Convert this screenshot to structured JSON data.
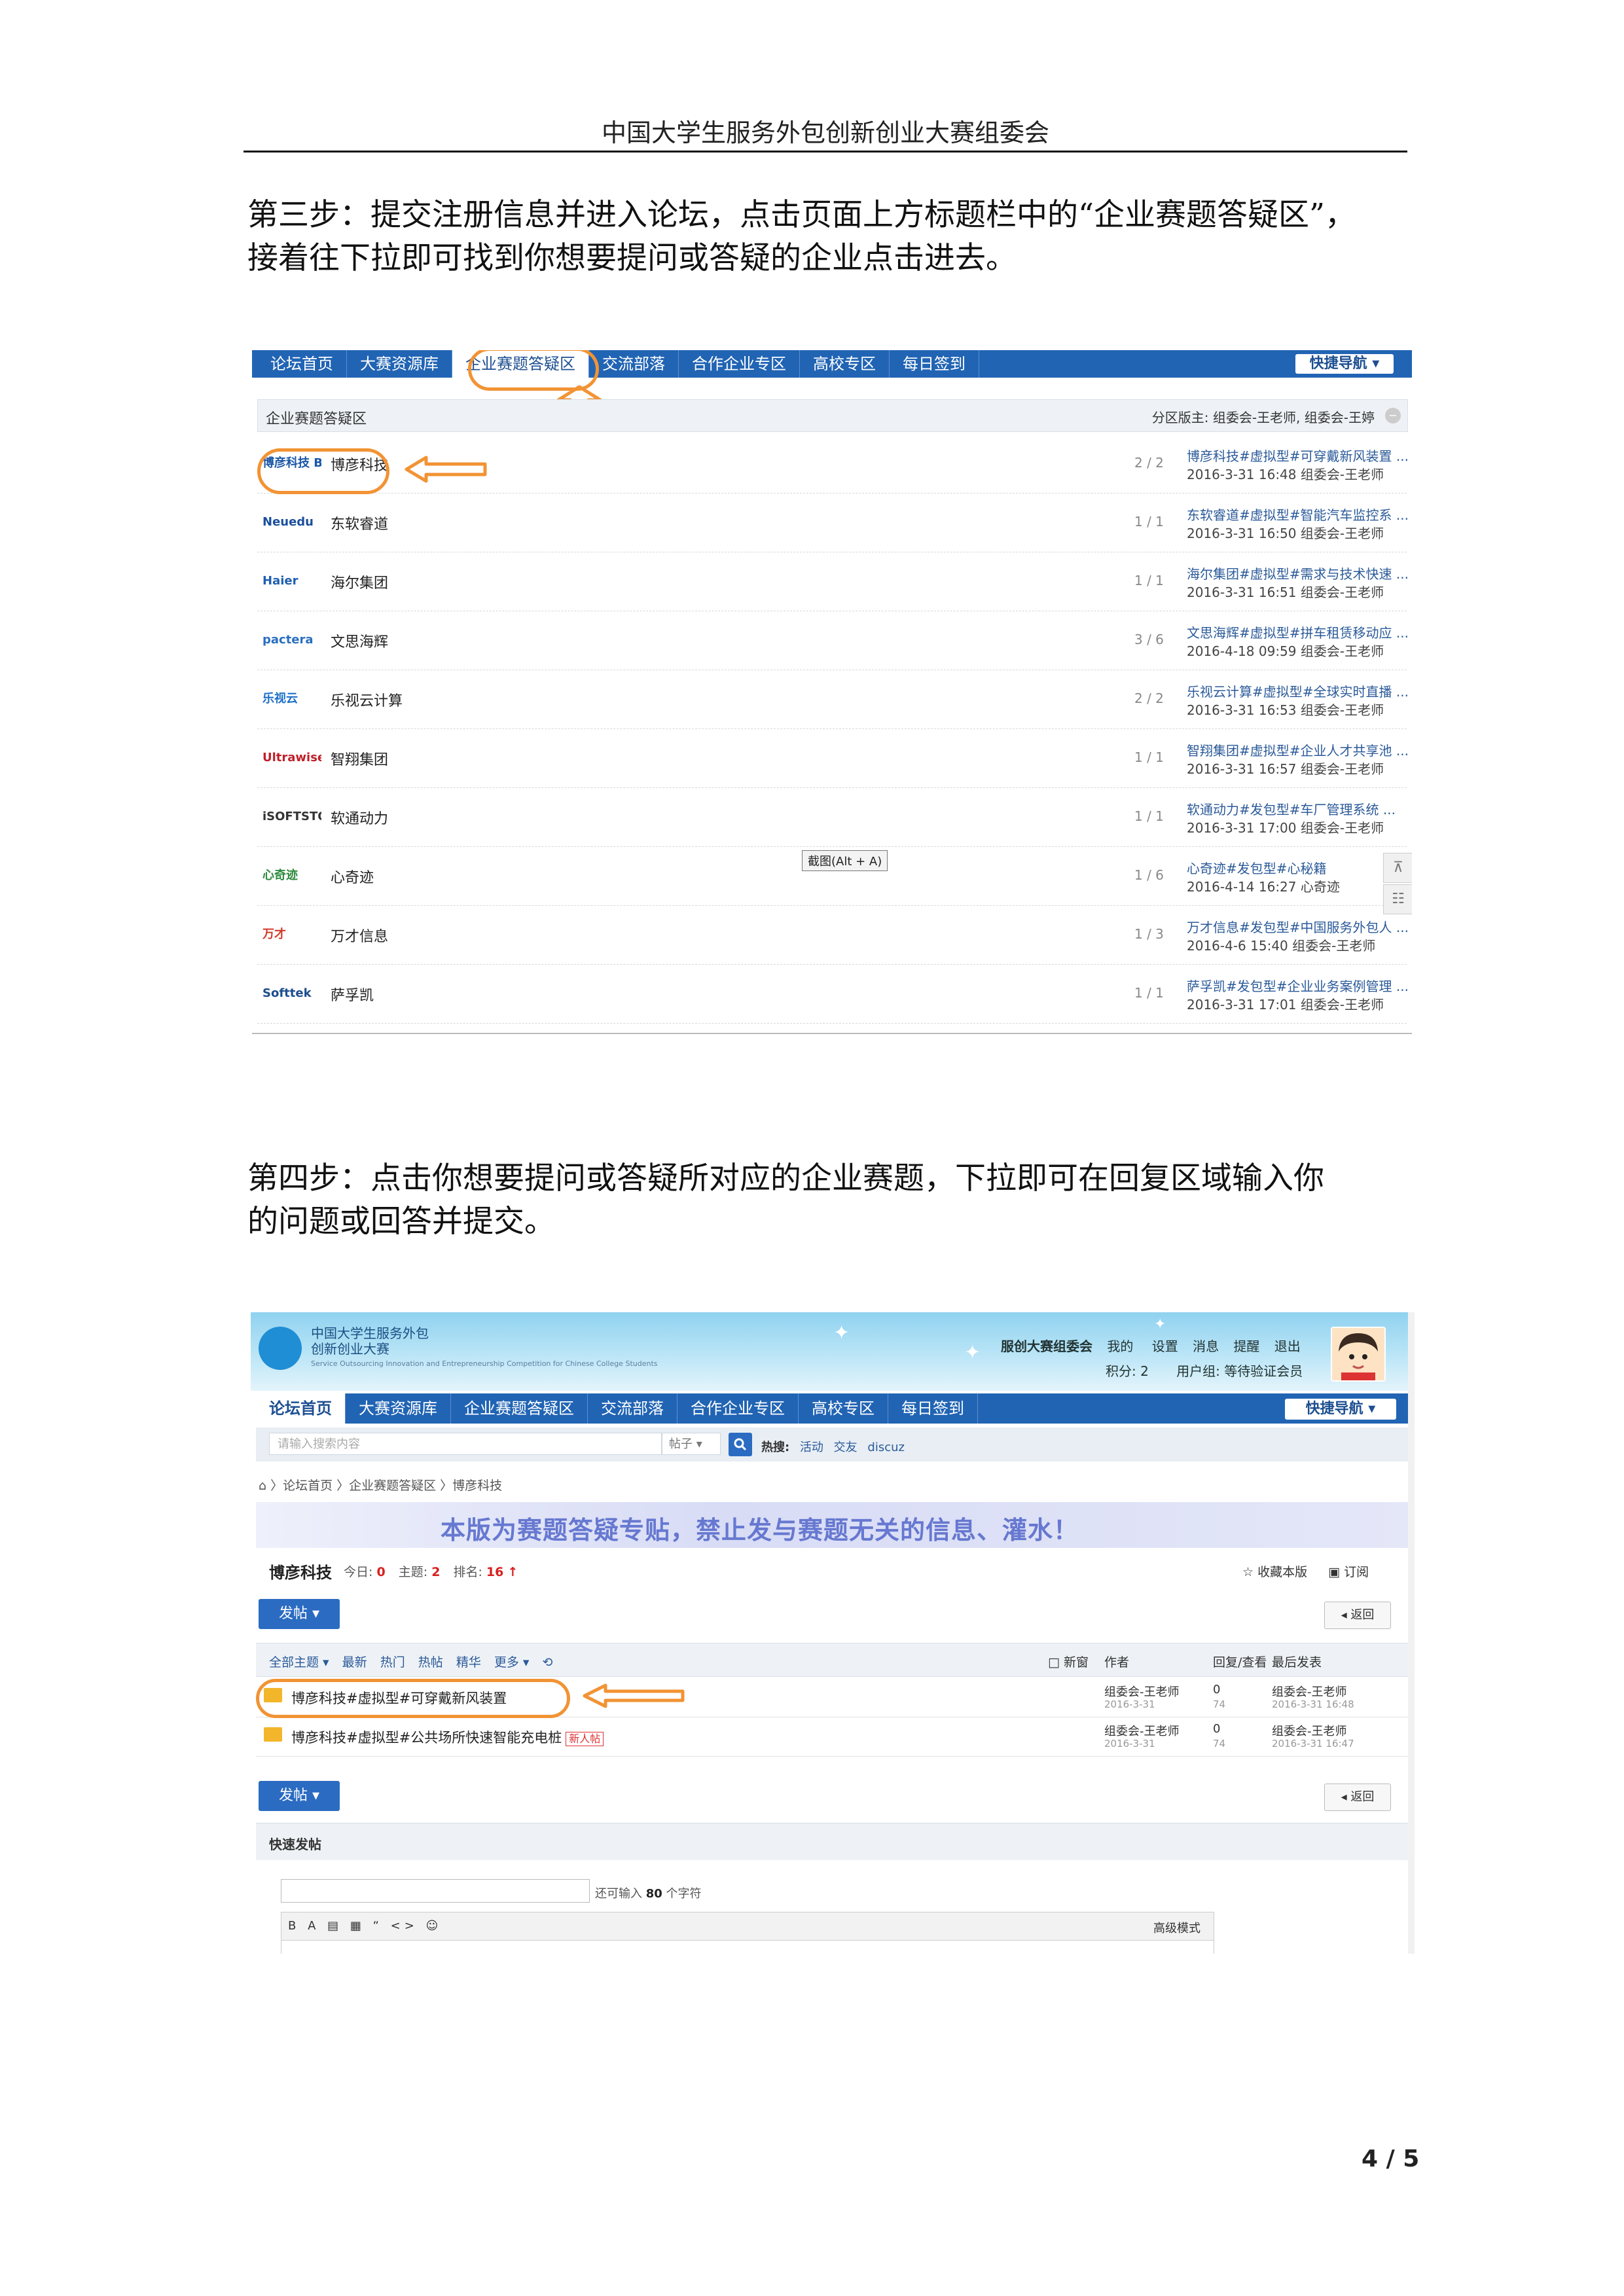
{
  "header": {
    "title": "中国大学生服务外包创新创业大赛组委会"
  },
  "step3": {
    "line1": "第三步：提交注册信息并进入论坛，点击页面上方标题栏中的“企业赛题答疑区”，",
    "line2": "接着往下拉即可找到你想要提问或答疑的企业点击进去。"
  },
  "shot1": {
    "nav_tabs": [
      "论坛首页",
      "大赛资源库",
      "企业赛题答疑区",
      "交流部落",
      "合作企业专区",
      "高校专区",
      "每日签到"
    ],
    "quick_nav": "快捷导航 ▾",
    "section_title": "企业赛题答疑区",
    "moderators": "分区版主: 组委会-王老师, 组委会-王婷",
    "collapse_icon": "−",
    "tooltip": "截图(Alt + A)",
    "side_tool_1": "⊼",
    "side_tool_2": "☷",
    "forums": [
      {
        "logo": "博彦科技 BEYONDSOFT",
        "name": "博彦科技",
        "count": "2 / 2",
        "latest": "博彦科技#虚拟型#可穿戴新风装置 ...",
        "meta": "2016-3-31 16:48 组委会-王老师",
        "logo_color": "#1a56a8"
      },
      {
        "logo": "Neuedu",
        "name": "东软睿道",
        "count": "1 / 1",
        "latest": "东软睿道#虚拟型#智能汽车监控系 ...",
        "meta": "2016-3-31 16:50 组委会-王老师",
        "logo_color": "#1a4f9c"
      },
      {
        "logo": "Haier",
        "name": "海尔集团",
        "count": "1 / 1",
        "latest": "海尔集团#虚拟型#需求与技术快速 ...",
        "meta": "2016-3-31 16:51 组委会-王老师",
        "logo_color": "#1f5fb0"
      },
      {
        "logo": "pactera",
        "name": "文思海辉",
        "count": "3 / 6",
        "latest": "文思海辉#虚拟型#拼车租赁移动应 ...",
        "meta": "2016-4-18 09:59 组委会-王老师",
        "logo_color": "#2a6fc0"
      },
      {
        "logo": "乐视云",
        "name": "乐视云计算",
        "count": "2 / 2",
        "latest": "乐视云计算#虚拟型#全球实时直播 ...",
        "meta": "2016-3-31 16:53 组委会-王老师",
        "logo_color": "#1d6fc7"
      },
      {
        "logo": "Ultrawise",
        "name": "智翔集团",
        "count": "1 / 1",
        "latest": "智翔集团#虚拟型#企业人才共享池 ...",
        "meta": "2016-3-31 16:57 组委会-王老师",
        "logo_color": "#c0202a"
      },
      {
        "logo": "iSOFTSTONE",
        "name": "软通动力",
        "count": "1 / 1",
        "latest": "软通动力#发包型#车厂管理系统 ...",
        "meta": "2016-3-31 17:00 组委会-王老师",
        "logo_color": "#333333"
      },
      {
        "logo": "心奇迹",
        "name": "心奇迹",
        "count": "1 / 6",
        "latest": "心奇迹#发包型#心秘籍",
        "meta": "2016-4-14 16:27 心奇迹",
        "logo_color": "#2d8a3e"
      },
      {
        "logo": "万才",
        "name": "万才信息",
        "count": "1 / 3",
        "latest": "万才信息#发包型#中国服务外包人 ...",
        "meta": "2016-4-6 15:40 组委会-王老师",
        "logo_color": "#d03a2a"
      },
      {
        "logo": "Softtek",
        "name": "萨孚凯",
        "count": "1 / 1",
        "latest": "萨孚凯#发包型#企业业务案例管理 ...",
        "meta": "2016-3-31 17:01 组委会-王老师",
        "logo_color": "#1c4e8c"
      }
    ]
  },
  "step4": {
    "line1": "第四步：点击你想要提问或答疑所对应的企业赛题，下拉即可在回复区域输入你",
    "line2": "的问题或回答并提交。"
  },
  "shot2": {
    "site_name_1": "中国大学生服务外包",
    "site_name_2": "创新创业大赛",
    "site_name_en": "Service Outsourcing Innovation and Entrepreneurship Competition for Chinese College Students",
    "user_name": "服创大赛组委会",
    "user_links": [
      "我的",
      "设置",
      "消息",
      "提醒",
      "退出"
    ],
    "points": "积分: 2",
    "user_group": "用户组: 等待验证会员",
    "nav_tabs": [
      "论坛首页",
      "大赛资源库",
      "企业赛题答疑区",
      "交流部落",
      "合作企业专区",
      "高校专区",
      "每日签到"
    ],
    "quick_nav": "快捷导航 ▾",
    "search_placeholder": "请输入搜索内容",
    "search_type": "帖子 ▾",
    "search_icon": "magnifier-icon",
    "hot_label": "热搜:",
    "hot_terms": [
      "活动",
      "交友",
      "discuz"
    ],
    "breadcrumb": "⌂ 〉论坛首页 〉企业赛题答疑区 〉博彦科技",
    "banner": "本版为赛题答疑专贴，禁止发与赛题无关的信息、灌水！",
    "forum_name": "博彦科技",
    "today_label": "今日: ",
    "today_value": "0",
    "topics_label": "主题: ",
    "topics_value": "2",
    "rank_label": "排名: ",
    "rank_value": "16",
    "rank_icon": "↑",
    "favorite": "☆ 收藏本版",
    "subscribe": "▣ 订阅",
    "post_button": "发帖 ▾",
    "back_button": "◂ 返回",
    "list_tabs": [
      "全部主题 ▾",
      "最新",
      "热门",
      "热帖",
      "精华",
      "更多 ▾",
      "⟲"
    ],
    "col_new": "□ 新窗",
    "col_author": "作者",
    "col_reply": "回复/查看",
    "col_last": "最后发表",
    "threads": [
      {
        "title": "博彦科技#虚拟型#可穿戴新风装置",
        "new": "",
        "author": "组委会-王老师",
        "author_date": "2016-3-31",
        "replies": "0",
        "views": "74",
        "last_user": "组委会-王老师",
        "last_time": "2016-3-31 16:48"
      },
      {
        "title": "博彦科技#虚拟型#公共场所快速智能充电桩",
        "new": "新人帖",
        "author": "组委会-王老师",
        "author_date": "2016-3-31",
        "replies": "0",
        "views": "74",
        "last_user": "组委会-王老师",
        "last_time": "2016-3-31 16:47"
      }
    ],
    "quick_post": "快速发帖",
    "remaining_prefix": "还可输入 ",
    "remaining_value": "80",
    "remaining_suffix": " 个字符",
    "editor_tools": "B A ▤ ▦ “ <> ☺",
    "advanced_mode": "高级模式"
  },
  "footer": {
    "page": "4 / 5"
  },
  "colors": {
    "nav_blue": "#2164b4",
    "annotation_orange": "#f29334"
  }
}
